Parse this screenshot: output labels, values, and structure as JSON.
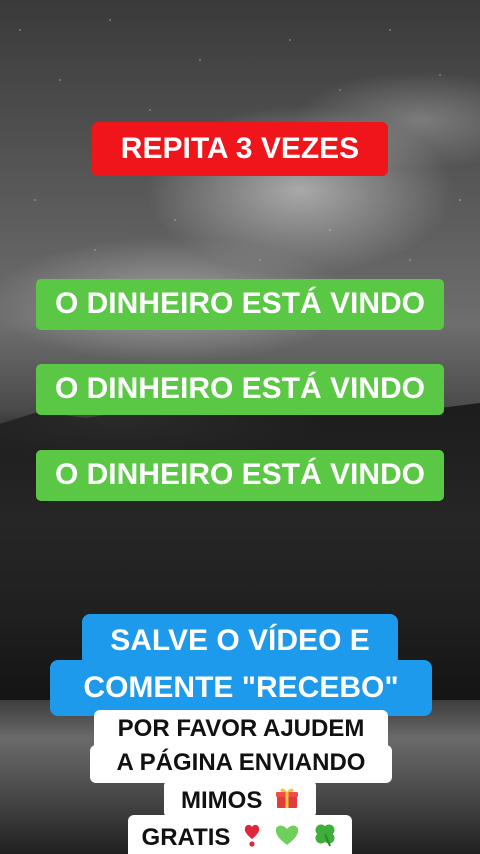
{
  "header": {
    "repeat_label": "REPITA 3 VEZES"
  },
  "affirmations": [
    "O DINHEIRO ESTÁ VINDO",
    "O DINHEIRO ESTÁ VINDO",
    "O DINHEIRO ESTÁ VINDO"
  ],
  "call_to_action": {
    "line1": "SALVE O VÍDEO E",
    "line2": "COMENTE \"RECEBO\""
  },
  "request": {
    "line1": "POR FAVOR AJUDEM",
    "line2": "A PÁGINA ENVIANDO",
    "line3": "MIMOS",
    "line4": "GRATIS"
  },
  "icons": {
    "gift": "gift-icon",
    "exclamation": "heavy-heart-exclamation-icon",
    "green_heart": "green-heart-icon",
    "clover": "four-leaf-clover-icon"
  },
  "colors": {
    "red_badge": "#f0141b",
    "green_badge": "#5ac845",
    "blue_badge": "#1d9aeb",
    "white_badge": "#ffffff"
  }
}
